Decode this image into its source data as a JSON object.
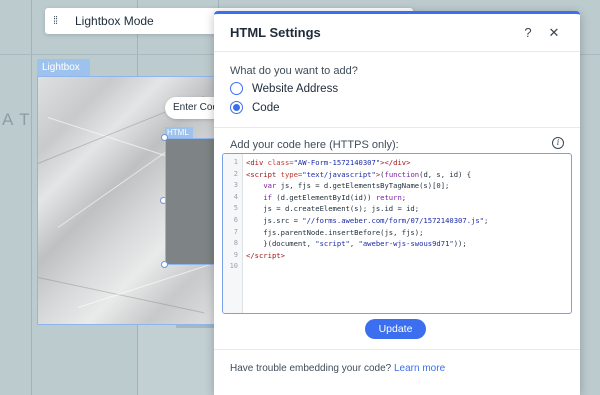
{
  "mode_bar": {
    "drag_icon": "drag-handle-icon",
    "title": "Lightbox Mode"
  },
  "canvas": {
    "background_word": "ATU"
  },
  "lightbox": {
    "tag": "Lightbox",
    "enter_pill": "Enter Code",
    "html_tag": "HTML"
  },
  "panel": {
    "title": "HTML Settings",
    "help_icon": "?",
    "close_icon": "✕",
    "question": "What do you want to add?",
    "options": [
      {
        "label": "Website Address",
        "checked": false
      },
      {
        "label": "Code",
        "checked": true
      }
    ],
    "code_label": "Add your code here (HTTPS only):",
    "info_icon": "i",
    "code_lines": [
      "1",
      "2",
      "3",
      "4",
      "5",
      "6",
      "7",
      "8",
      "9",
      "10"
    ],
    "update_label": "Update",
    "footer_text": "Have trouble embedding your code?",
    "footer_link": "Learn more"
  },
  "colors": {
    "accent": "#3b6ff0",
    "selection": "#9ec2ee",
    "canvas": "#bccbce"
  }
}
